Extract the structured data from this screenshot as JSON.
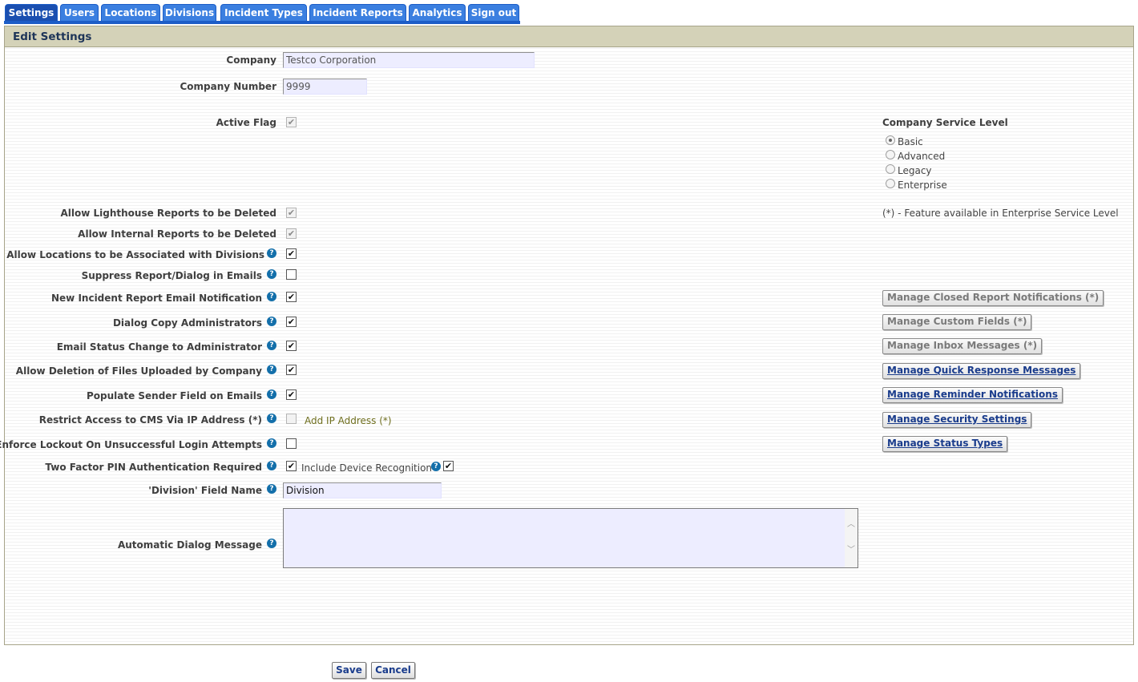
{
  "tabs": [
    {
      "label": "Settings",
      "active": true
    },
    {
      "label": "Users"
    },
    {
      "label": "Locations"
    },
    {
      "label": "Divisions"
    },
    {
      "label": "Incident Types"
    },
    {
      "label": "Incident Reports"
    },
    {
      "label": "Analytics"
    },
    {
      "label": "Sign out"
    }
  ],
  "panel": {
    "title": "Edit Settings"
  },
  "fields": {
    "company": {
      "label": "Company",
      "value": "Testco Corporation"
    },
    "company_number": {
      "label": "Company Number",
      "value": "9999"
    },
    "active_flag": {
      "label": "Active Flag",
      "checked": true,
      "disabled": true
    },
    "allow_lighthouse_delete": {
      "label": "Allow Lighthouse Reports to be Deleted",
      "checked": true,
      "disabled": true
    },
    "allow_internal_delete": {
      "label": "Allow Internal Reports to be Deleted",
      "checked": true,
      "disabled": true
    },
    "allow_locations_divisions": {
      "label": "Allow Locations to be Associated with Divisions",
      "checked": true
    },
    "suppress_report_dialog": {
      "label": "Suppress Report/Dialog in Emails",
      "checked": false
    },
    "new_incident_email": {
      "label": "New Incident Report Email Notification",
      "checked": true
    },
    "dialog_copy_admins": {
      "label": "Dialog Copy Administrators",
      "checked": true
    },
    "email_status_change": {
      "label": "Email Status Change to Administrator",
      "checked": true
    },
    "allow_deletion_files": {
      "label": "Allow Deletion of Files Uploaded by Company",
      "checked": true
    },
    "populate_sender": {
      "label": "Populate Sender Field on Emails",
      "checked": true
    },
    "restrict_ip": {
      "label": "Restrict Access to CMS Via IP Address (*)",
      "checked": false,
      "disabled": true,
      "link": "Add IP Address (*)"
    },
    "enforce_lockout": {
      "label": "Enforce Lockout On Unsuccessful Login Attempts",
      "checked": false
    },
    "two_factor": {
      "label": "Two Factor PIN Authentication Required",
      "checked": true,
      "include_label": "Include Device Recognition",
      "include_checked": true
    },
    "division_field_name": {
      "label": "'Division' Field Name",
      "value": "Division"
    },
    "auto_dialog_message": {
      "label": "Automatic Dialog Message",
      "value": ""
    }
  },
  "service_level": {
    "title": "Company Service Level",
    "options": [
      "Basic",
      "Advanced",
      "Legacy",
      "Enterprise"
    ],
    "selected": "Basic",
    "note": "(*) - Feature available in Enterprise Service Level"
  },
  "manage_buttons": [
    {
      "label": "Manage Closed Report Notifications (*)",
      "enabled": false
    },
    {
      "label": "Manage Custom Fields (*)",
      "enabled": false
    },
    {
      "label": "Manage Inbox Messages (*)",
      "enabled": false
    },
    {
      "label": "Manage Quick Response Messages",
      "enabled": true
    },
    {
      "label": "Manage Reminder Notifications",
      "enabled": true
    },
    {
      "label": "Manage Security Settings",
      "enabled": true
    },
    {
      "label": "Manage Status Types",
      "enabled": true
    }
  ],
  "actions": {
    "save": "Save",
    "cancel": "Cancel"
  },
  "icons": {
    "help": "question-mark-icon",
    "check": "check-icon"
  },
  "colors": {
    "tab": "#3b7fe0",
    "tab_active": "#1a4fb0",
    "header": "#d4d2b8",
    "link": "#1a3c8c",
    "ip_link": "#6e6e1e"
  }
}
